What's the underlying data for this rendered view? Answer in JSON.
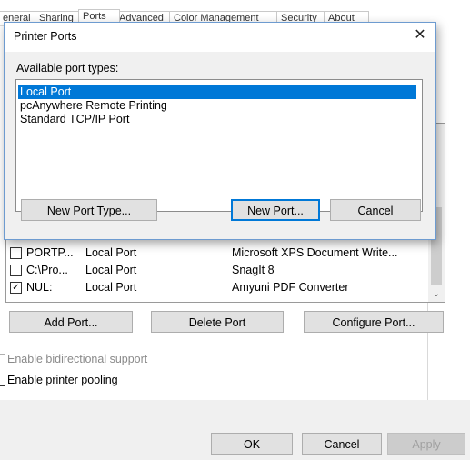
{
  "tabs": [
    {
      "label": "eneral"
    },
    {
      "label": "Sharing"
    },
    {
      "label": "Ports"
    },
    {
      "label": "Advanced"
    },
    {
      "label": "Color Management"
    },
    {
      "label": "Security"
    },
    {
      "label": "About"
    }
  ],
  "ports": {
    "rows": [
      {
        "port": "PORTP...",
        "description": "Local Port",
        "printer": "Microsoft XPS Document Write...",
        "checked": false,
        "check_glyph": ""
      },
      {
        "port": "C:\\Pro...",
        "description": "Local Port",
        "printer": "SnagIt 8",
        "checked": false,
        "check_glyph": ""
      },
      {
        "port": "NUL:",
        "description": "Local Port",
        "printer": "Amyuni PDF Converter",
        "checked": true,
        "check_glyph": "✓"
      }
    ],
    "scroll_down_glyph": "⌄"
  },
  "buttons": {
    "add_port": "Add Port...",
    "delete_port": "Delete Port",
    "configure_port": "Configure Port...",
    "ok": "OK",
    "cancel": "Cancel",
    "apply": "Apply"
  },
  "options": {
    "bidirectional": "Enable bidirectional support",
    "pooling": "Enable printer pooling"
  },
  "dialog": {
    "title": "Printer Ports",
    "close_glyph": "✕",
    "list_label": "Available port types:",
    "port_types": [
      {
        "label": "Local Port",
        "selected": true
      },
      {
        "label": "pcAnywhere Remote Printing",
        "selected": false
      },
      {
        "label": "Standard TCP/IP Port",
        "selected": false
      }
    ],
    "new_port_type": "New Port Type...",
    "new_port": "New Port...",
    "cancel": "Cancel"
  },
  "colors": {
    "selection": "#0078d7",
    "button_face": "#e1e1e1",
    "dialog_border": "#6d9bd0"
  }
}
